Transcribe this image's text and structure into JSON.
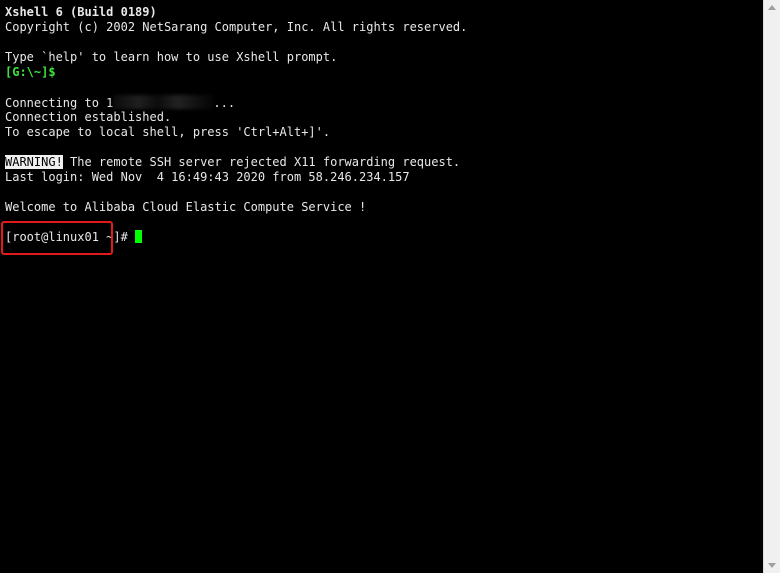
{
  "terminal": {
    "banner_title": "Xshell 6 (Build 0189)",
    "copyright": "Copyright (c) 2002 NetSarang Computer, Inc. All rights reserved.",
    "help_text": "Type `help' to learn how to use Xshell prompt.",
    "local_prompt": "[G:\\~]$",
    "connecting_prefix": "Connecting to 1",
    "connecting_suffix": "...",
    "established": "Connection established.",
    "escape_hint": "To escape to local shell, press 'Ctrl+Alt+]'.",
    "warning_label": "WARNING!",
    "warning_text": " The remote SSH server rejected X11 forwarding request.",
    "last_login": "Last login: Wed Nov  4 16:49:43 2020 from 58.246.234.157",
    "welcome": "Welcome to Alibaba Cloud Elastic Compute Service !",
    "remote_prompt": "[root@linux01 ~]#"
  },
  "colors": {
    "background": "#000000",
    "text": "#e8e8e8",
    "prompt_green": "#3ce43c",
    "cursor": "#00ff00",
    "highlight_box": "#e21a1a",
    "scrollbar": "#f0f0f0"
  },
  "icons": {
    "scroll_up": "chevron-up-icon",
    "scroll_down": "chevron-down-icon"
  }
}
